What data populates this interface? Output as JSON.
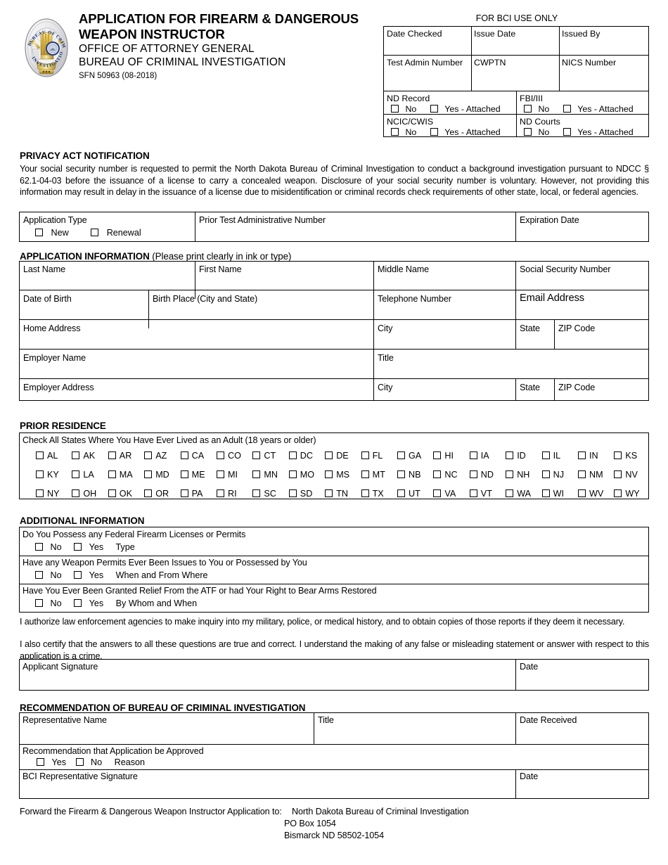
{
  "header": {
    "title_line1": "APPLICATION FOR FIREARM & DANGEROUS",
    "title_line2": "WEAPON INSTRUCTOR",
    "office": "OFFICE OF ATTORNEY GENERAL",
    "bureau": "BUREAU OF CRIMINAL INVESTIGATION",
    "form_number": "SFN 50963 (08-2018)",
    "seal_top_text": "BUREAU OF CRIMINAL",
    "seal_bottom_text": "INVESTIGATION"
  },
  "bci": {
    "heading": "FOR BCI USE ONLY",
    "date_checked": "Date Checked",
    "issue_date": "Issue Date",
    "issued_by": "Issued By",
    "test_admin_number": "Test Admin Number",
    "cwptn": "CWPTN",
    "nics_number": "NICS Number",
    "nd_record": "ND Record",
    "fbi_iii": "FBI/III",
    "ncic_cwis": "NCIC/CWIS",
    "nd_courts": "ND Courts",
    "no": "No",
    "yes_attached": "Yes - Attached"
  },
  "privacy": {
    "heading": "PRIVACY ACT NOTIFICATION",
    "body": "Your social security number is requested to permit the North Dakota Bureau of Criminal Investigation to conduct a background investigation pursuant to NDCC § 62.1-04-03 before the issuance of a license to carry a concealed weapon.  Disclosure of your social security number is voluntary.  However, not providing this information may result in delay in the issuance of a license due to misidentification or criminal records check requirements of other state, local, or federal agencies."
  },
  "application_type": {
    "label": "Application Type",
    "new": "New",
    "renewal": "Renewal",
    "prior_test_number": "Prior Test Administrative Number",
    "expiration_date": "Expiration Date"
  },
  "app_info": {
    "heading_bold": "APPLICATION INFORMATION",
    "heading_normal": " (Please print clearly in ink or type)",
    "last_name": "Last Name",
    "first_name": "First Name",
    "middle_name": "Middle Name",
    "ssn": "Social Security Number",
    "date_of_birth": "Date of Birth",
    "birth_place": "Birth Place (City and State)",
    "telephone": "Telephone Number",
    "email": "Email Address",
    "home_address": "Home Address",
    "city": "City",
    "state": "State",
    "zip": "ZIP Code",
    "employer_name": "Employer Name",
    "title": "Title",
    "employer_address": "Employer Address"
  },
  "prior_residence": {
    "heading": "PRIOR RESIDENCE",
    "instruction": "Check All States Where You Have Ever Lived as an Adult (18 years or older)",
    "rows": [
      [
        "AL",
        "AK",
        "AR",
        "AZ",
        "CA",
        "CO",
        "CT",
        "DC",
        "DE",
        "FL",
        "GA",
        "HI",
        "IA",
        "ID",
        "IL",
        "IN",
        "KS"
      ],
      [
        "KY",
        "LA",
        "MA",
        "MD",
        "ME",
        "MI",
        "MN",
        "MO",
        "MS",
        "MT",
        "NB",
        "NC",
        "ND",
        "NH",
        "NJ",
        "NM",
        "NV"
      ],
      [
        "NY",
        "OH",
        "OK",
        "OR",
        "PA",
        "RI",
        "SC",
        "SD",
        "TN",
        "TX",
        "UT",
        "VA",
        "VT",
        "WA",
        "WI",
        "WV",
        "WY"
      ]
    ]
  },
  "additional": {
    "heading": "ADDITIONAL INFORMATION",
    "q1": "Do You Possess any Federal Firearm Licenses or Permits",
    "q1_extra": "Type",
    "q2": "Have any Weapon Permits Ever Been Issues to You or Possessed by You",
    "q2_extra": "When and From Where",
    "q3": "Have You Ever Been Granted Relief From the ATF or had Your Right to Bear Arms Restored",
    "q3_extra": "By Whom and When",
    "no": "No",
    "yes": "Yes",
    "authorize": "I authorize law enforcement agencies to make inquiry into my military, police, or medical history, and to obtain copies of those reports if they deem it necessary.",
    "certify": "I also certify that the answers to all these questions are true and correct.  I understand the making of any false or misleading statement or answer with respect to this application is a crime.",
    "applicant_signature": "Applicant Signature",
    "date": "Date"
  },
  "recommendation": {
    "heading": "RECOMMENDATION OF BUREAU OF CRIMINAL INVESTIGATION",
    "representative_name": "Representative Name",
    "title": "Title",
    "date_received": "Date Received",
    "approved_label": "Recommendation that Application be Approved",
    "yes": "Yes",
    "no": "No",
    "reason": "Reason",
    "bci_signature": "BCI Representative Signature",
    "date": "Date"
  },
  "footer": {
    "forward_label": "Forward the Firearm & Dangerous Weapon Instructor Application to:",
    "addr1": "North Dakota Bureau of Criminal Investigation",
    "addr2": "PO Box 1054",
    "addr3": "Bismarck ND 58502-1054"
  }
}
